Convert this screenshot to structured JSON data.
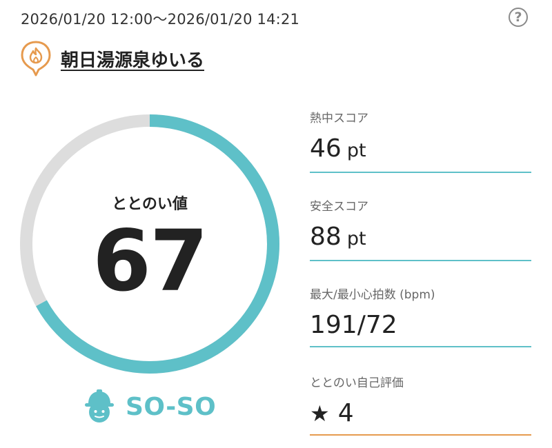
{
  "header": {
    "datetime": "2026/01/20 12:00〜2026/01/20 14:21",
    "help_icon": "question-circle-icon",
    "help_glyph": "?"
  },
  "facility": {
    "icon": "hot-spring-pin-icon",
    "name": "朝日湯源泉ゆいる"
  },
  "gauge": {
    "label": "ととのい値",
    "value": "67",
    "fill_fraction": 0.67,
    "fill_color": "#5ec0c8",
    "track_color": "#dddddd"
  },
  "status": {
    "icon": "face-with-hat-icon",
    "text": "SO-SO",
    "color": "#5ec0c8"
  },
  "metrics": [
    {
      "label": "熱中スコア",
      "value": "46",
      "unit": "pt"
    },
    {
      "label": "安全スコア",
      "value": "88",
      "unit": "pt"
    },
    {
      "label": "最大/最小心拍数 (bpm)",
      "value": "191/72"
    },
    {
      "label": "ととのい自己評価",
      "value": "4",
      "icon": "star-icon",
      "star": "★"
    }
  ],
  "colors": {
    "accent_teal": "#5ec0c8",
    "accent_orange": "#e69a4e"
  }
}
